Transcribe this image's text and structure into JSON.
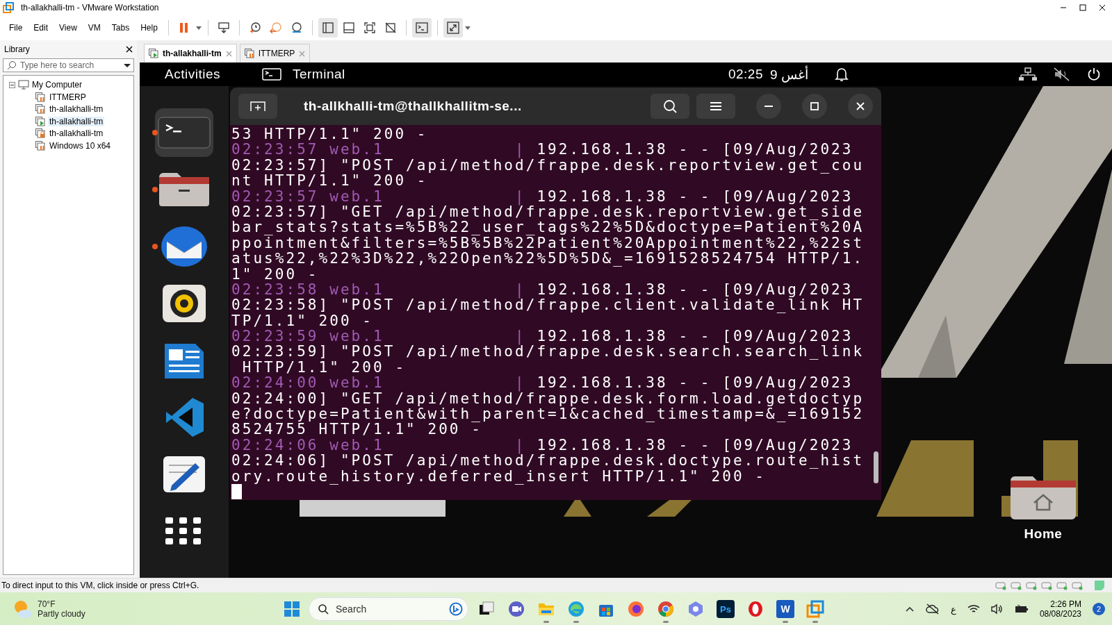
{
  "window": {
    "title": "th-allakhalli-tm - VMware Workstation"
  },
  "menu": [
    "File",
    "Edit",
    "View",
    "VM",
    "Tabs",
    "Help"
  ],
  "library": {
    "title": "Library",
    "search": {
      "placeholder": "Type here to search"
    },
    "tree": [
      {
        "label": "My Computer",
        "expanded": true,
        "children": [
          {
            "label": "ITTMERP",
            "kind": "paused",
            "selected": false
          },
          {
            "label": "th-allakhalli-tm",
            "kind": "paused",
            "selected": false
          },
          {
            "label": "th-allakhalli-tm",
            "kind": "running",
            "selected": true
          },
          {
            "label": "th-allakhalli-tm",
            "kind": "locked",
            "selected": false
          },
          {
            "label": "Windows 10 x64",
            "kind": "paused",
            "selected": false
          }
        ]
      }
    ]
  },
  "tabs": [
    {
      "label": "th-allakhalli-tm",
      "kind": "running",
      "selected": true
    },
    {
      "label": "ITTMERP",
      "kind": "paused",
      "selected": false
    }
  ],
  "vm": {
    "topbar": {
      "activities": "Activities",
      "app": "Terminal",
      "time": "02:25",
      "date": "9 أغس"
    },
    "dock": [
      {
        "kind": "terminal",
        "running": true,
        "selected": true
      },
      {
        "kind": "files",
        "running": true,
        "selected": false
      },
      {
        "kind": "mail",
        "running": true,
        "selected": false
      },
      {
        "kind": "music",
        "running": false,
        "selected": false
      },
      {
        "kind": "writer",
        "running": false,
        "selected": false
      },
      {
        "kind": "code",
        "running": false,
        "selected": false
      },
      {
        "kind": "editor",
        "running": false,
        "selected": false
      },
      {
        "kind": "apps",
        "running": false,
        "selected": false
      }
    ],
    "terminal": {
      "title": "th-allkhalli-tm@thallkhallitm-se...",
      "lines": [
        {
          "kind": "text",
          "text": "53 HTTP/1.1\" 200 -"
        },
        {
          "kind": "entry",
          "time": "02:23:57 web.1",
          "sep": "|",
          "text": "192.168.1.38 - - [09/Aug/2023"
        },
        {
          "kind": "text",
          "text": "02:23:57] \"POST /api/method/frappe.desk.reportview.get_cou"
        },
        {
          "kind": "text",
          "text": "nt HTTP/1.1\" 200 -"
        },
        {
          "kind": "entry",
          "time": "02:23:57 web.1",
          "sep": "|",
          "text": "192.168.1.38 - - [09/Aug/2023"
        },
        {
          "kind": "text",
          "text": "02:23:57] \"GET /api/method/frappe.desk.reportview.get_side"
        },
        {
          "kind": "text",
          "text": "bar_stats?stats=%5B%22_user_tags%22%5D&doctype=Patient%20A"
        },
        {
          "kind": "text",
          "text": "ppointment&filters=%5B%5B%22Patient%20Appointment%22,%22st"
        },
        {
          "kind": "text",
          "text": "atus%22,%22%3D%22,%22Open%22%5D%5D&_=1691528524754 HTTP/1."
        },
        {
          "kind": "text",
          "text": "1\" 200 -"
        },
        {
          "kind": "entry",
          "time": "02:23:58 web.1",
          "sep": "|",
          "text": "192.168.1.38 - - [09/Aug/2023"
        },
        {
          "kind": "text",
          "text": "02:23:58] \"POST /api/method/frappe.client.validate_link HT"
        },
        {
          "kind": "text",
          "text": "TP/1.1\" 200 -"
        },
        {
          "kind": "entry",
          "time": "02:23:59 web.1",
          "sep": "|",
          "text": "192.168.1.38 - - [09/Aug/2023"
        },
        {
          "kind": "text",
          "text": "02:23:59] \"POST /api/method/frappe.desk.search.search_link"
        },
        {
          "kind": "text",
          "text": " HTTP/1.1\" 200 -"
        },
        {
          "kind": "entry",
          "time": "02:24:00 web.1",
          "sep": "|",
          "text": "192.168.1.38 - - [09/Aug/2023"
        },
        {
          "kind": "text",
          "text": "02:24:00] \"GET /api/method/frappe.desk.form.load.getdoctyp"
        },
        {
          "kind": "text",
          "text": "e?doctype=Patient&with_parent=1&cached_timestamp=&_=169152"
        },
        {
          "kind": "text",
          "text": "8524755 HTTP/1.1\" 200 -"
        },
        {
          "kind": "entry",
          "time": "02:24:06 web.1",
          "sep": "|",
          "text": "192.168.1.38 - - [09/Aug/2023"
        },
        {
          "kind": "text",
          "text": "02:24:06] \"POST /api/method/frappe.desk.doctype.route_hist"
        },
        {
          "kind": "text",
          "text": "ory.route_history.deferred_insert HTTP/1.1\" 200 -"
        }
      ]
    },
    "desktop_icon": {
      "label": "Home"
    }
  },
  "status_bar": {
    "text": "To direct input to this VM, click inside or press Ctrl+G."
  },
  "taskbar": {
    "weather": {
      "temp": "70°F",
      "condition": "Partly cloudy"
    },
    "search": {
      "placeholder": "Search"
    },
    "apps": [
      {
        "kind": "taskview",
        "running": false
      },
      {
        "kind": "meet",
        "running": false
      },
      {
        "kind": "files",
        "running": true
      },
      {
        "kind": "edge",
        "running": true
      },
      {
        "kind": "store",
        "running": false
      },
      {
        "kind": "firefox",
        "running": false
      },
      {
        "kind": "chrome",
        "running": true
      },
      {
        "kind": "copilot",
        "running": false
      },
      {
        "kind": "photoshop",
        "running": false,
        "label": "Ps"
      },
      {
        "kind": "opera",
        "running": false
      },
      {
        "kind": "word",
        "running": true,
        "label": "W"
      },
      {
        "kind": "vmware",
        "running": true
      }
    ],
    "language": "ع",
    "time": "2:26 PM",
    "date": "08/08/2023",
    "notifications": "2"
  }
}
